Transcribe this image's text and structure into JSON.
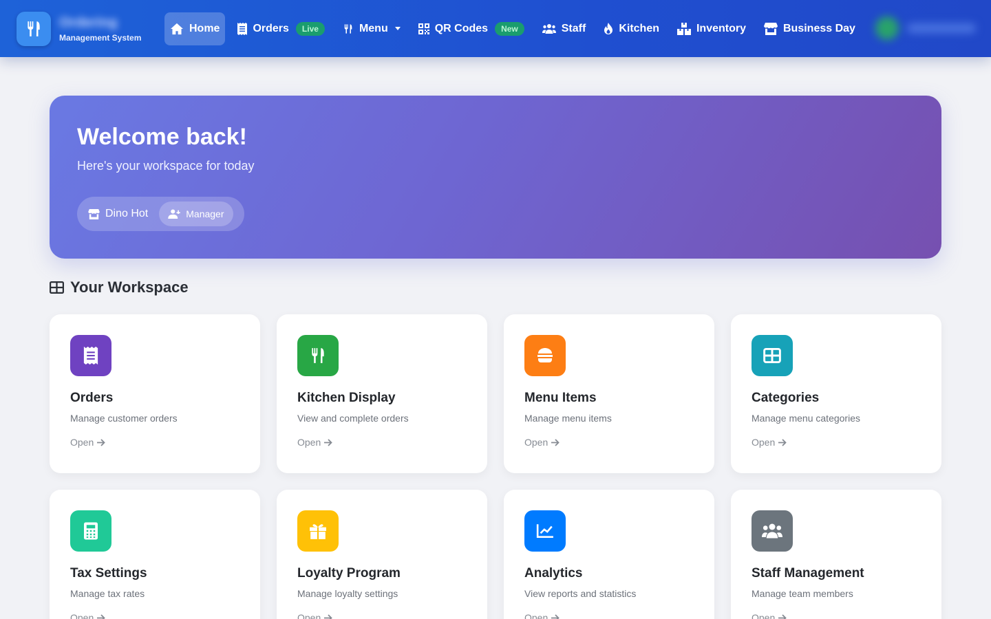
{
  "brand": {
    "name": "Ordering",
    "subtitle": "Management System"
  },
  "nav": [
    {
      "label": "Home",
      "icon": "home-icon",
      "active": true
    },
    {
      "label": "Orders",
      "icon": "receipt-icon",
      "badge": "Live"
    },
    {
      "label": "Menu",
      "icon": "utensils-icon",
      "dropdown": true
    },
    {
      "label": "QR Codes",
      "icon": "qrcode-icon",
      "badge": "New"
    },
    {
      "label": "Staff",
      "icon": "users-icon"
    },
    {
      "label": "Kitchen",
      "icon": "fire-icon"
    },
    {
      "label": "Inventory",
      "icon": "boxes-icon"
    },
    {
      "label": "Business Day",
      "icon": "store-icon"
    }
  ],
  "hero": {
    "title": "Welcome back!",
    "subtitle": "Here's your workspace for today",
    "store": "Dino Hot",
    "role": "Manager"
  },
  "workspace": {
    "title": "Your Workspace",
    "open_label": "Open",
    "cards": [
      {
        "title": "Orders",
        "desc": "Manage customer orders",
        "icon": "receipt-icon",
        "color": "#6f42c1"
      },
      {
        "title": "Kitchen Display",
        "desc": "View and complete orders",
        "icon": "utensils-icon",
        "color": "#28a745"
      },
      {
        "title": "Menu Items",
        "desc": "Manage menu items",
        "icon": "hamburger-icon",
        "color": "#fd7e14"
      },
      {
        "title": "Categories",
        "desc": "Manage menu categories",
        "icon": "grid-icon",
        "color": "#17a2b8"
      },
      {
        "title": "Tax Settings",
        "desc": "Manage tax rates",
        "icon": "calculator-icon",
        "color": "#20c997"
      },
      {
        "title": "Loyalty Program",
        "desc": "Manage loyalty settings",
        "icon": "gift-icon",
        "color": "#ffc107"
      },
      {
        "title": "Analytics",
        "desc": "View reports and statistics",
        "icon": "chart-line-icon",
        "color": "#007bff"
      },
      {
        "title": "Staff Management",
        "desc": "Manage team members",
        "icon": "users-icon",
        "color": "#6c757d"
      }
    ]
  }
}
